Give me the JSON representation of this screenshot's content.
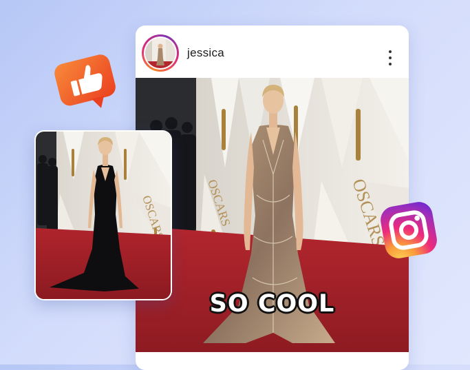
{
  "post": {
    "username": "jessica",
    "caption": "SO COOL",
    "more_icon": "more-vertical-icon"
  },
  "backdrop_text": "OSCARS",
  "badges": {
    "like": "thumbs-up-icon",
    "instagram": "instagram-logo-icon"
  },
  "colors": {
    "background": "#c6d3f8",
    "like_badge": "#f05a28",
    "carpet": "#a6232b",
    "instagram_gradient": [
      "#f9ce34",
      "#ee2a7b",
      "#6228d7"
    ]
  }
}
